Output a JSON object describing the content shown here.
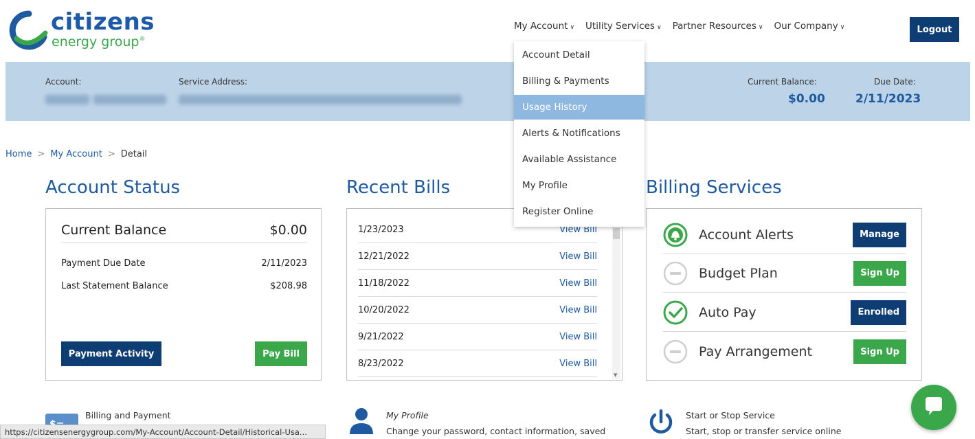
{
  "brand": {
    "name": "citizens",
    "sub": "energy group",
    "tm": "®",
    "primary_color": "#1e5aa0",
    "accent_color": "#3aa84a",
    "navy_color": "#0d3d73"
  },
  "topnav": {
    "items": [
      {
        "label": "My Account"
      },
      {
        "label": "Utility Services"
      },
      {
        "label": "Partner Resources"
      },
      {
        "label": "Our Company"
      }
    ],
    "logout_label": "Logout"
  },
  "dropdown": {
    "items": [
      {
        "label": "Account Detail"
      },
      {
        "label": "Billing & Payments"
      },
      {
        "label": "Usage History",
        "active": true
      },
      {
        "label": "Alerts & Notifications"
      },
      {
        "label": "Available Assistance"
      },
      {
        "label": "My Profile"
      },
      {
        "label": "Register Online"
      }
    ]
  },
  "account_bar": {
    "account_label": "Account:",
    "service_address_label": "Service Address:",
    "current_balance_label": "Current Balance:",
    "current_balance_value": "$0.00",
    "due_date_label": "Due Date:",
    "due_date_value": "2/11/2023"
  },
  "breadcrumb": {
    "items": [
      "Home",
      "My Account",
      "Detail"
    ],
    "sep": ">"
  },
  "account_status": {
    "title": "Account Status",
    "current_balance_label": "Current Balance",
    "current_balance_value": "$0.00",
    "payment_due_label": "Payment Due Date",
    "payment_due_value": "2/11/2023",
    "last_statement_label": "Last Statement Balance",
    "last_statement_value": "$208.98",
    "payment_activity_label": "Payment Activity",
    "pay_bill_label": "Pay Bill"
  },
  "recent_bills": {
    "title": "Recent Bills",
    "rows": [
      {
        "date": "1/23/2023",
        "link": "View Bill"
      },
      {
        "date": "12/21/2022",
        "link": "View Bill"
      },
      {
        "date": "11/18/2022",
        "link": "View Bill"
      },
      {
        "date": "10/20/2022",
        "link": "View Bill"
      },
      {
        "date": "9/21/2022",
        "link": "View Bill"
      },
      {
        "date": "8/23/2022",
        "link": "View Bill"
      }
    ]
  },
  "billing_services": {
    "title": "Billing Services",
    "rows": [
      {
        "label": "Account Alerts",
        "button": "Manage",
        "icon": "bell-icon"
      },
      {
        "label": "Budget Plan",
        "button": "Sign Up",
        "icon": "minus-circle-icon"
      },
      {
        "label": "Auto Pay",
        "button": "Enrolled",
        "icon": "check-circle-icon"
      },
      {
        "label": "Pay Arrangement",
        "button": "Sign Up",
        "icon": "minus-circle-icon"
      }
    ]
  },
  "bottom": {
    "billing_title": "Billing and Payment",
    "profile_title": "My Profile",
    "profile_desc": "Change your password, contact information, saved",
    "service_title": "Start or Stop Service",
    "service_desc": "Start, stop or transfer service online"
  },
  "status_url": "https://citizensenergygroup.com/My-Account/Account-Detail/Historical-Usa..."
}
